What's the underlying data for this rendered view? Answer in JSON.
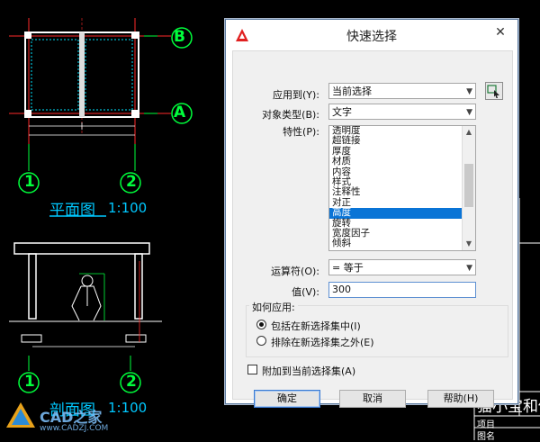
{
  "dialog": {
    "title": "快速选择",
    "close_label": "✕",
    "apply_to": {
      "label": "应用到(Y):",
      "value": "当前选择"
    },
    "object_type": {
      "label": "对象类型(B):",
      "value": "文字"
    },
    "properties": {
      "label": "特性(P):",
      "items": [
        "透明度",
        "超链接",
        "厚度",
        "材质",
        "内容",
        "样式",
        "注释性",
        "对正",
        "高度",
        "旋转",
        "宽度因子",
        "倾斜"
      ],
      "selected": "高度"
    },
    "operator": {
      "label": "运算符(O):",
      "value": "= 等于"
    },
    "value": {
      "label": "值(V):",
      "value": "300"
    },
    "how_to_apply": {
      "label": "如何应用:",
      "include": "包括在新选择集中(I)",
      "exclude": "排除在新选择集之外(E)",
      "selected": "include"
    },
    "append_label": "附加到当前选择集(A)",
    "append_checked": false,
    "buttons": {
      "ok": "确定",
      "cancel": "取消",
      "help": "帮助(H)"
    }
  },
  "drawing": {
    "plan_title": "平面图",
    "plan_scale": "1:100",
    "section_title": "剖面图",
    "section_scale": "1:100",
    "axis_b": "B",
    "axis_a": "A",
    "axis_1": "1",
    "axis_2": "2",
    "title_block": {
      "heading": "猫小宝和他",
      "row1": "项目",
      "row2": "图名"
    },
    "watermark": {
      "brand": "CAD之家",
      "url": "www.CADZJ.COM"
    }
  },
  "colors": {
    "cad_bg": "#000000",
    "axis_green": "#00ff3c",
    "title_cyan": "#00c8ff",
    "dim_line": "#ff0000",
    "dialog_accent": "#0a74d6"
  }
}
